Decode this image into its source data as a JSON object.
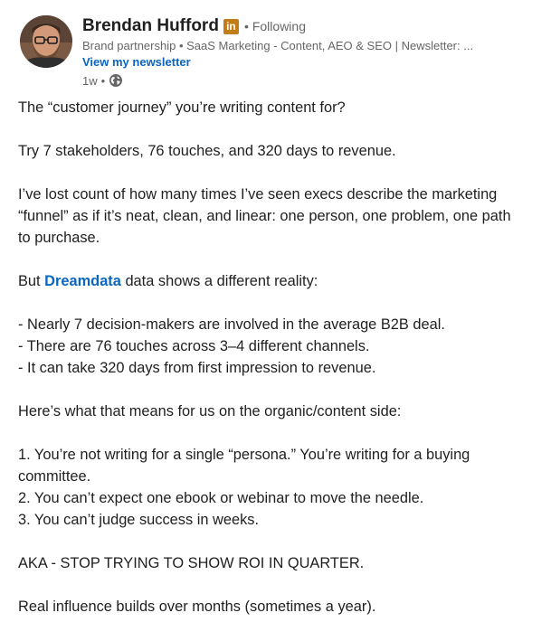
{
  "author": {
    "name": "Brendan Hufford",
    "badge": "in",
    "follow_separator": "•",
    "follow_status": "Following",
    "headline": "Brand partnership • SaaS Marketing - Content, AEO & SEO | Newsletter: ...",
    "newsletter_link": "View my newsletter",
    "time_ago": "1w",
    "meta_separator": "•",
    "visibility_icon": "globe-icon"
  },
  "post": {
    "p1": "The “customer journey” you’re writing content for?",
    "p2": "Try 7 stakeholders, 76 touches, and 320 days to revenue.",
    "p3_l1": "I’ve lost count of how many times I’ve seen execs describe the marketing",
    "p3_l2": "“funnel” as if it’s neat, clean, and linear: one person, one problem, one path",
    "p3_l3": "to purchase.",
    "p4_prefix": "But ",
    "p4_mention": "Dreamdata",
    "p4_suffix": " data shows a different reality:",
    "bullets": [
      "- Nearly 7 decision-makers are involved in the average B2B deal.",
      "- There are 76 touches across 3–4 different channels.",
      "- It can take 320 days from first impression to revenue."
    ],
    "p6": "Here’s what that means for us on the organic/content side:",
    "numbered": [
      "1. You’re not writing for a single “persona.” You’re writing for a buying",
      "committee.",
      "2. You can’t expect one ebook or webinar to move the needle.",
      "3. You can’t judge success in weeks."
    ],
    "p8": "AKA - STOP TRYING TO SHOW ROI IN QUARTER.",
    "p9": "Real influence builds over months (sometimes a year)."
  },
  "colors": {
    "link": "#0a66c2",
    "muted": "#666666",
    "text": "#1f1f1f",
    "badge": "#c37d16"
  }
}
